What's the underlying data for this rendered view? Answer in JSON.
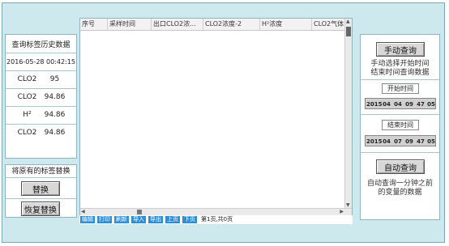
{
  "left_panel": {
    "title": "查询标签历史数据",
    "datetime": "2016-05-28 00:42:15",
    "readings": [
      {
        "label": "CLO2",
        "value": "95"
      },
      {
        "label": "CLO2",
        "value": "94.86"
      },
      {
        "label": "H²",
        "value": "94.86"
      },
      {
        "label": "CLO2",
        "value": "94.86"
      }
    ],
    "replace_title": "将原有的标签替换",
    "replace_button": "替换",
    "restore_button": "恢复替换"
  },
  "table": {
    "columns": [
      "序号",
      "采样时间",
      "出口CLO2浓...",
      "CLO2浓度-2",
      "H²浓度",
      "CLO2气体..."
    ],
    "rows": []
  },
  "toolbar": {
    "buttons": [
      "编辑",
      "打印",
      "刷新",
      "导入",
      "导出",
      "上页",
      "下页"
    ],
    "page_info": "第1页,共0页"
  },
  "right_panel": {
    "manual_button": "手动查询",
    "manual_desc_1": "手动选择开始时间",
    "manual_desc_2": "结束时间查询数据",
    "start_caption": "开始时间",
    "start_values": [
      "2015",
      "04",
      "04",
      "09",
      "47",
      "05"
    ],
    "end_caption": "结束时间",
    "end_values": [
      "2015",
      "04",
      "07",
      "09",
      "47",
      "05"
    ],
    "auto_button": "自动查询",
    "auto_desc_1": "自动查询一分钟之前",
    "auto_desc_2": "的变量的数据"
  },
  "colors": {
    "background": "#cde9ee",
    "toolbar_button": "#2f8fd6"
  }
}
